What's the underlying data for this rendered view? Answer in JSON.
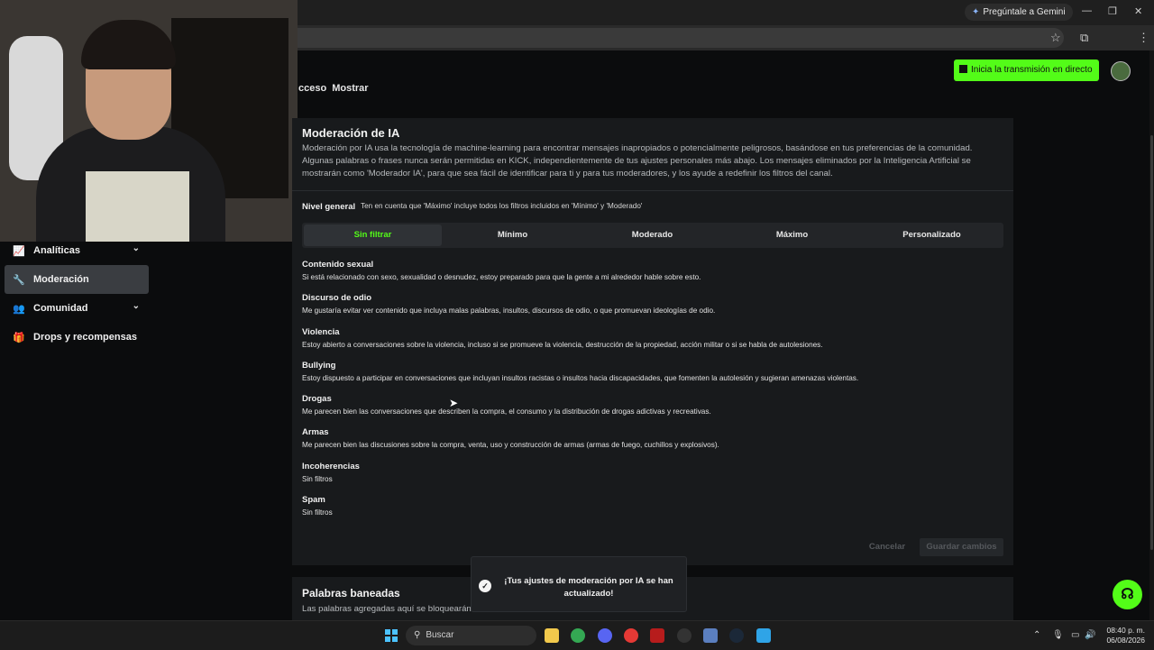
{
  "browser": {
    "gemini_label": "Pregúntale a Gemini",
    "icons": {
      "star": "star-icon",
      "extensions": "puzzle-icon",
      "menu": "kebab-icon"
    }
  },
  "header": {
    "live_button": "Inicia la transmisión en directo",
    "tabs_partial": [
      "cceso",
      "Mostrar"
    ]
  },
  "sidebar": {
    "items": [
      {
        "label": "Analíticas",
        "icon": "chart-icon",
        "expandable": true
      },
      {
        "label": "Moderación",
        "icon": "wrench-icon",
        "active": true
      },
      {
        "label": "Comunidad",
        "icon": "people-icon",
        "expandable": true
      },
      {
        "label": "Drops y recompensas",
        "icon": "gift-icon"
      }
    ]
  },
  "ai_moderation": {
    "title": "Moderación de IA",
    "description": "Moderación por IA usa la tecnología de machine-learning para encontrar mensajes inapropiados o potencialmente peligrosos, basándose en tus preferencias de la comunidad. Algunas palabras o frases nunca serán permitidas en KICK, independientemente de tus ajustes personales más abajo. Los mensajes eliminados por la Inteligencia Artificial se mostrarán como 'Moderador IA', para que sea fácil de identificar para ti y para tus moderadores, y los ayude a redefinir los filtros del canal.",
    "level_label": "Nivel general",
    "level_note": "Ten en cuenta que 'Máximo' incluye todos los filtros incluidos en 'Mínimo' y 'Moderado'",
    "levels": [
      "Sin filtrar",
      "Mínimo",
      "Moderado",
      "Máximo",
      "Personalizado"
    ],
    "selected_level": "Sin filtrar",
    "filters": [
      {
        "title": "Contenido sexual",
        "desc": "Si está relacionado con sexo, sexualidad o desnudez, estoy preparado para que la gente a mi alrededor hable sobre esto."
      },
      {
        "title": "Discurso de odio",
        "desc": "Me gustaría evitar ver contenido que incluya malas palabras, insultos, discursos de odio, o que promuevan ideologías de odio."
      },
      {
        "title": "Violencia",
        "desc": "Estoy abierto a conversaciones sobre la violencia, incluso si se promueve la violencia, destrucción de la propiedad, acción militar o si se habla de autolesiones."
      },
      {
        "title": "Bullying",
        "desc": "Estoy dispuesto a participar en conversaciones que incluyan insultos racistas o insultos hacia discapacidades, que fomenten la autolesión y sugieran amenazas violentas."
      },
      {
        "title": "Drogas",
        "desc": "Me parecen bien las conversaciones que describen la compra, el consumo y la distribución de drogas adictivas y recreativas."
      },
      {
        "title": "Armas",
        "desc": "Me parecen bien las discusiones sobre la compra, venta, uso y construcción de armas (armas de fuego, cuchillos y explosivos)."
      },
      {
        "title": "Incoherencias",
        "desc": "Sin filtros"
      },
      {
        "title": "Spam",
        "desc": "Sin filtros"
      }
    ],
    "cancel_label": "Cancelar",
    "save_label": "Guardar cambios"
  },
  "banned_words": {
    "title": "Palabras baneadas",
    "desc": "Las palabras agregadas aquí se bloquearán automáticamente en tu chat."
  },
  "toast": {
    "message": "¡Tus ajustes de moderación por IA se han actualizado!"
  },
  "taskbar": {
    "search_placeholder": "Buscar",
    "time": "08:40 p. m.",
    "date": "06/08/2026"
  },
  "colors": {
    "accent": "#53fc18",
    "background": "#0b0c0d",
    "card": "#181a1c"
  }
}
